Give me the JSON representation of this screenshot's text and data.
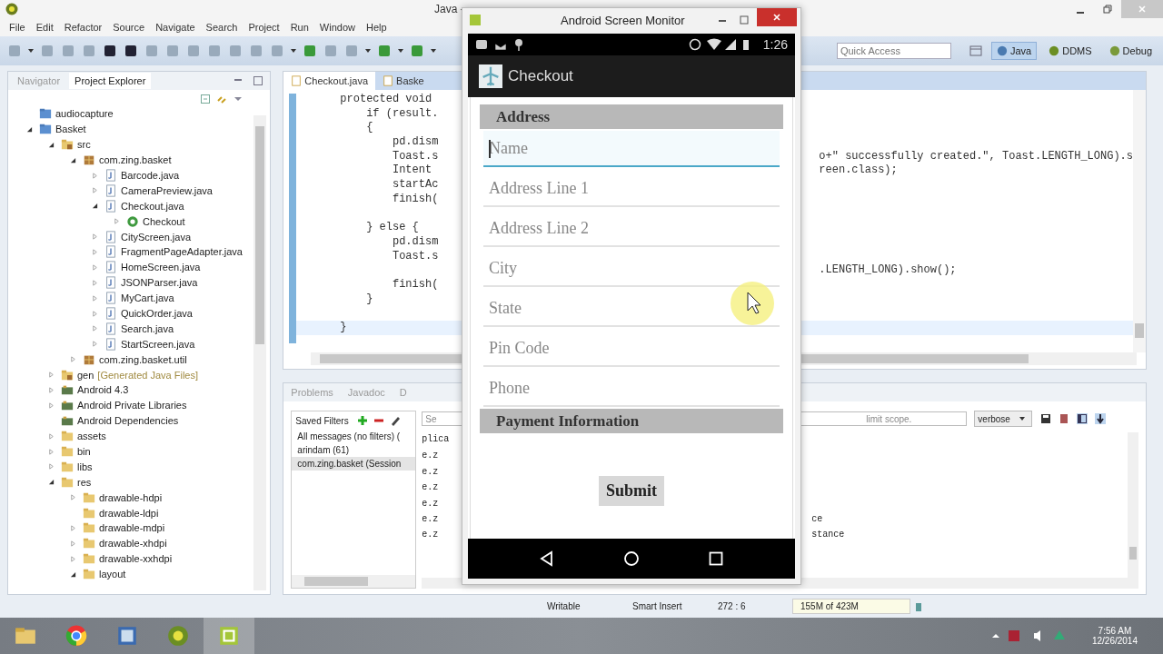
{
  "window": {
    "title": "Java -"
  },
  "menu": [
    "File",
    "Edit",
    "Refactor",
    "Source",
    "Navigate",
    "Search",
    "Project",
    "Run",
    "Window",
    "Help"
  ],
  "quick_access": {
    "placeholder": "Quick Access"
  },
  "perspectives": [
    {
      "label": "Java",
      "selected": true
    },
    {
      "label": "DDMS",
      "selected": false
    },
    {
      "label": "Debug",
      "selected": false
    }
  ],
  "explorer": {
    "tabs": [
      {
        "label": "Navigator",
        "selected": false
      },
      {
        "label": "Project Explorer",
        "selected": true
      }
    ],
    "tree": [
      {
        "label": "audiocapture",
        "kind": "project"
      },
      {
        "label": "Basket",
        "kind": "project",
        "expanded": true,
        "children": [
          {
            "label": "src",
            "kind": "source",
            "expanded": true,
            "children": [
              {
                "label": "com.zing.basket",
                "kind": "package",
                "expanded": true,
                "children": [
                  {
                    "label": "Barcode.java",
                    "kind": "java",
                    "expanded": false
                  },
                  {
                    "label": "CameraPreview.java",
                    "kind": "java",
                    "expanded": false
                  },
                  {
                    "label": "Checkout.java",
                    "kind": "java",
                    "expanded": true,
                    "children": [
                      {
                        "label": "Checkout",
                        "kind": "class",
                        "expanded": false
                      }
                    ]
                  },
                  {
                    "label": "CityScreen.java",
                    "kind": "java",
                    "expanded": false
                  },
                  {
                    "label": "FragmentPageAdapter.java",
                    "kind": "java",
                    "expanded": false
                  },
                  {
                    "label": "HomeScreen.java",
                    "kind": "java",
                    "expanded": false
                  },
                  {
                    "label": "JSONParser.java",
                    "kind": "java",
                    "expanded": false
                  },
                  {
                    "label": "MyCart.java",
                    "kind": "java",
                    "expanded": false
                  },
                  {
                    "label": "QuickOrder.java",
                    "kind": "java",
                    "expanded": false
                  },
                  {
                    "label": "Search.java",
                    "kind": "java",
                    "expanded": false
                  },
                  {
                    "label": "StartScreen.java",
                    "kind": "java",
                    "expanded": false
                  }
                ]
              },
              {
                "label": "com.zing.basket.util",
                "kind": "package",
                "expanded": false
              }
            ]
          },
          {
            "label": "gen",
            "note": "[Generated Java Files]",
            "kind": "source",
            "expanded": false
          },
          {
            "label": "Android 4.3",
            "kind": "library",
            "expanded": false
          },
          {
            "label": "Android Private Libraries",
            "kind": "library",
            "expanded": false
          },
          {
            "label": "Android Dependencies",
            "kind": "library"
          },
          {
            "label": "assets",
            "kind": "folder",
            "expanded": false
          },
          {
            "label": "bin",
            "kind": "folder",
            "expanded": false
          },
          {
            "label": "libs",
            "kind": "folder",
            "expanded": false
          },
          {
            "label": "res",
            "kind": "folder",
            "expanded": true,
            "children": [
              {
                "label": "drawable-hdpi",
                "kind": "folder",
                "expanded": false
              },
              {
                "label": "drawable-ldpi",
                "kind": "folder"
              },
              {
                "label": "drawable-mdpi",
                "kind": "folder",
                "expanded": false
              },
              {
                "label": "drawable-xhdpi",
                "kind": "folder",
                "expanded": false
              },
              {
                "label": "drawable-xxhdpi",
                "kind": "folder",
                "expanded": false
              },
              {
                "label": "layout",
                "kind": "folder",
                "expanded": true
              }
            ]
          }
        ]
      }
    ]
  },
  "editor": {
    "tabs": [
      {
        "label": "Checkout.java",
        "selected": true
      },
      {
        "label": "Baske",
        "selected": false
      }
    ],
    "lines": [
      {
        "kind": "code",
        "left": "protected void",
        "current": false
      },
      {
        "kind": "code",
        "left": "    if (result.",
        "current": false
      },
      {
        "kind": "code",
        "left": "    {",
        "current": false
      },
      {
        "kind": "code",
        "left": "        pd.dism",
        "current": false
      },
      {
        "kind": "code",
        "left": "        Toast.s",
        "right": "o+\" successfully created.\", Toast.LENGTH_LONG).s",
        "current": false
      },
      {
        "kind": "code",
        "left": "        Intent",
        "right": "reen.class);",
        "current": false
      },
      {
        "kind": "code",
        "left": "        startAc",
        "current": false
      },
      {
        "kind": "code",
        "left": "        finish(",
        "current": false
      },
      {
        "kind": "blank",
        "current": false
      },
      {
        "kind": "code",
        "left": "    } else {",
        "current": false
      },
      {
        "kind": "code",
        "left": "        pd.dism",
        "current": false
      },
      {
        "kind": "code",
        "left": "        Toast.s",
        "current": false
      },
      {
        "kind": "code",
        "right": ".LENGTH_LONG).show();",
        "current": false
      },
      {
        "kind": "code",
        "left": "        finish(",
        "current": false
      },
      {
        "kind": "code",
        "left": "    }",
        "current": false
      },
      {
        "kind": "blank",
        "current": false
      },
      {
        "kind": "code",
        "left": "}",
        "current": true
      }
    ]
  },
  "console": {
    "tabs": [
      "Problems",
      "Javadoc",
      "D"
    ],
    "saved_filters": {
      "title": "Saved Filters",
      "items": [
        {
          "label": "All messages (no filters) (",
          "selected": false
        },
        {
          "label": "arindam (61)",
          "selected": false
        },
        {
          "label": "com.zing.basket (Session",
          "selected": true
        }
      ]
    },
    "search": {
      "placeholder_start": "Se",
      "placeholder_end": "limit scope."
    },
    "level": "verbose",
    "log": {
      "header": "plica",
      "rows": [
        {
          "left": "e.z"
        },
        {
          "left": "e.z"
        },
        {
          "left": "e.z"
        },
        {
          "left": "e.z"
        },
        {
          "left": "e.z",
          "right": "ce"
        },
        {
          "left": "e.z",
          "right": "stance"
        }
      ]
    }
  },
  "status_bar": {
    "items": [
      "Writable",
      "Smart Insert",
      "272 : 6"
    ],
    "memory": "155M of 423M"
  },
  "taskbar": {
    "time": "7:56 AM",
    "date": "12/26/2014"
  },
  "monitor": {
    "title": "Android Screen Monitor",
    "time": "1:26",
    "app_title": "Checkout",
    "form": [
      {
        "kind": "section",
        "label": "Address"
      },
      {
        "kind": "field",
        "placeholder": "Name",
        "focused": true
      },
      {
        "kind": "field",
        "placeholder": "Address Line 1",
        "focused": false
      },
      {
        "kind": "field",
        "placeholder": "Address Line 2",
        "focused": false
      },
      {
        "kind": "field",
        "placeholder": "City",
        "focused": false
      },
      {
        "kind": "field",
        "placeholder": "State",
        "focused": false
      },
      {
        "kind": "field",
        "placeholder": "Pin Code",
        "focused": false
      },
      {
        "kind": "field",
        "placeholder": "Phone",
        "focused": false
      },
      {
        "kind": "section",
        "label": "Payment Information"
      }
    ],
    "submit": "Submit"
  }
}
